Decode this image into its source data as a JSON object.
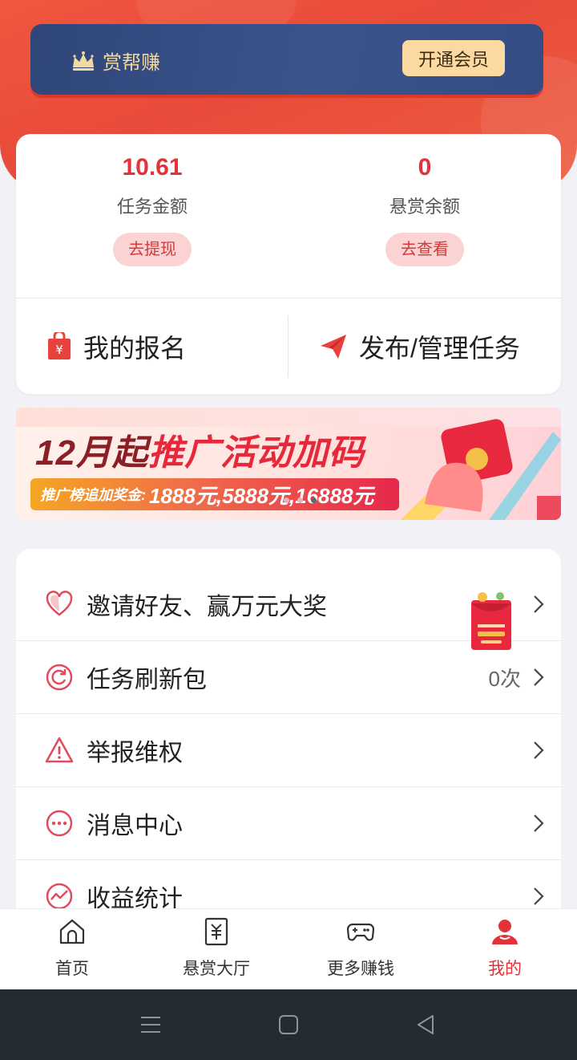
{
  "header": {
    "brand": "赏帮赚",
    "open_vip_label": "开通会员"
  },
  "wallet": {
    "task_amount": {
      "value": "10.61",
      "label": "任务金额",
      "button": "去提现"
    },
    "reward_balance": {
      "value": "0",
      "label": "悬赏余额",
      "button": "去查看"
    },
    "signup_label": "我的报名",
    "publish_label": "发布/管理任务"
  },
  "banner": {
    "title_prefix": "12月起",
    "title_highlight": "推广活动加码",
    "sub_prefix": "推广榜追加奖金:",
    "sub_amounts": "1888元,5888元,16888元",
    "gift_text": "邀请好友 赢万元大奖"
  },
  "menu": [
    {
      "label": "邀请好友、赢万元大奖",
      "value": "",
      "icon": "heart-icon"
    },
    {
      "label": "任务刷新包",
      "value": "0次",
      "icon": "refresh-icon"
    },
    {
      "label": "举报维权",
      "value": "",
      "icon": "warning-icon"
    },
    {
      "label": "消息中心",
      "value": "",
      "icon": "message-icon"
    },
    {
      "label": "收益统计",
      "value": "",
      "icon": "chart-icon"
    }
  ],
  "tabbar": [
    {
      "label": "首页",
      "icon": "home-icon"
    },
    {
      "label": "悬赏大厅",
      "icon": "bounty-icon"
    },
    {
      "label": "更多赚钱",
      "icon": "gamepad-icon"
    },
    {
      "label": "我的",
      "icon": "user-icon",
      "active": true
    }
  ],
  "colors": {
    "accent": "#e3323a",
    "header_red": "#ee5a3f",
    "vip_navy": "#344d84",
    "vip_gold": "#fbd9a1"
  }
}
